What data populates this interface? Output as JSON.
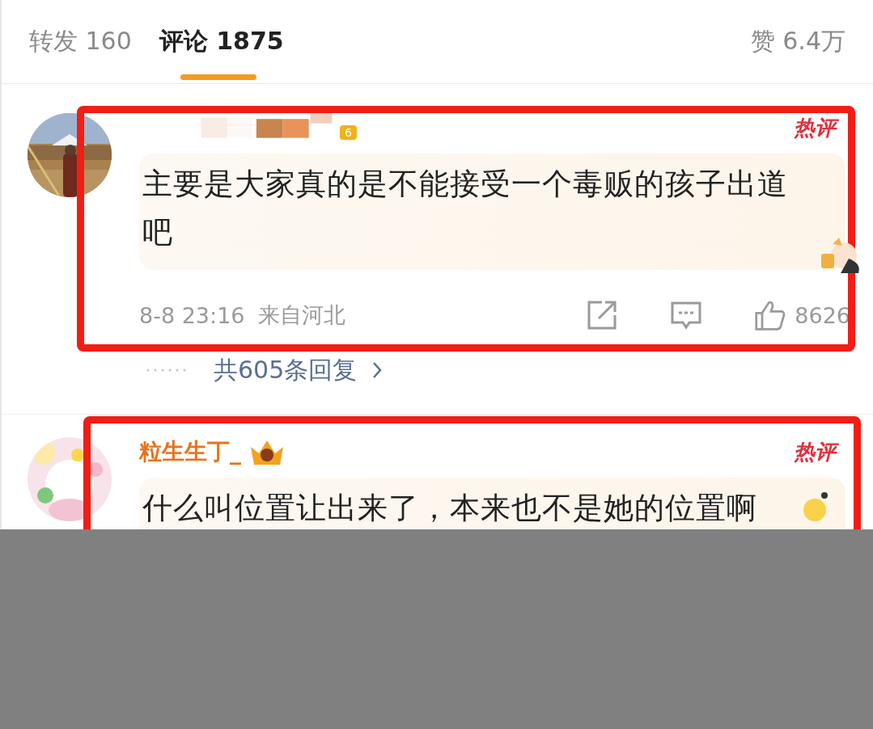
{
  "tabs": [
    {
      "label": "转发",
      "count": "160",
      "selected": false
    },
    {
      "label": "评论",
      "count": "1875",
      "selected": true
    }
  ],
  "likes": {
    "label": "赞",
    "count": "6.4万"
  },
  "comments": [
    {
      "highlighted": true,
      "username_censored": true,
      "level_badge": "6",
      "tag": "热评",
      "text": "主要是大家真的是不能接受一个毒贩的孩子出道吧",
      "time": "8-8 23:16",
      "location": "来自河北",
      "like_count": "8626",
      "replies": "共605条回复"
    },
    {
      "highlighted": true,
      "username_censored": false,
      "username": "粒生生丁_",
      "tag": "热评",
      "text": "什么叫位置让出来了，本来也不是她的位置啊"
    }
  ]
}
